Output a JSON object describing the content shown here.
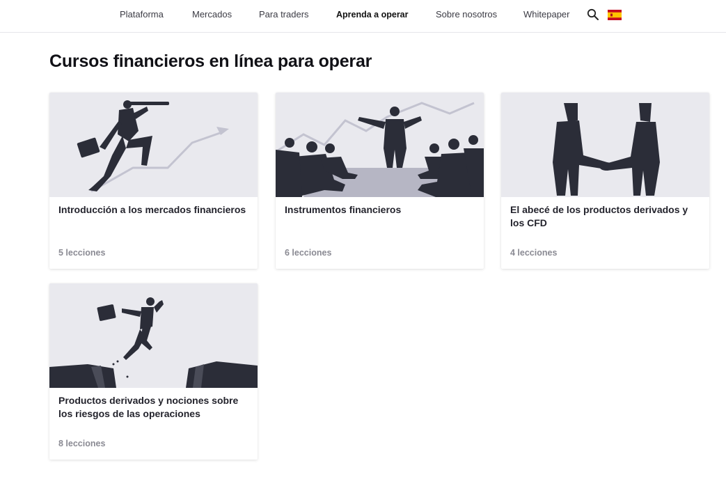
{
  "nav": {
    "items": [
      {
        "label": "Plataforma"
      },
      {
        "label": "Mercados"
      },
      {
        "label": "Para traders"
      },
      {
        "label": "Aprenda a operar"
      },
      {
        "label": "Sobre nosotros"
      },
      {
        "label": "Whitepaper"
      }
    ],
    "active": "Aprenda a operar",
    "search_icon": "search-icon",
    "language_icon": "spain-flag-icon",
    "flag_colors": {
      "red": "#c60b1e",
      "yellow": "#ffc400"
    }
  },
  "page": {
    "title": "Cursos financieros en línea para operar"
  },
  "courses": [
    {
      "title": "Introducción a los mercados financieros",
      "lessons": "5 lecciones",
      "illustration": "businessman-telescope-icon"
    },
    {
      "title": "Instrumentos financieros",
      "lessons": "6 lecciones",
      "illustration": "meeting-presentation-icon"
    },
    {
      "title": "El abecé de los productos derivados y los CFD",
      "lessons": "4 lecciones",
      "illustration": "handshake-icon"
    },
    {
      "title": "Productos derivados y nociones sobre los riesgos de las operaciones",
      "lessons": "8 lecciones",
      "illustration": "jumping-over-gap-icon"
    }
  ],
  "colors": {
    "card_image_bg": "#e9e9ee",
    "figure": "#2b2d38",
    "trend_line": "#c3c3d0",
    "meta_text": "#8a8a93"
  }
}
